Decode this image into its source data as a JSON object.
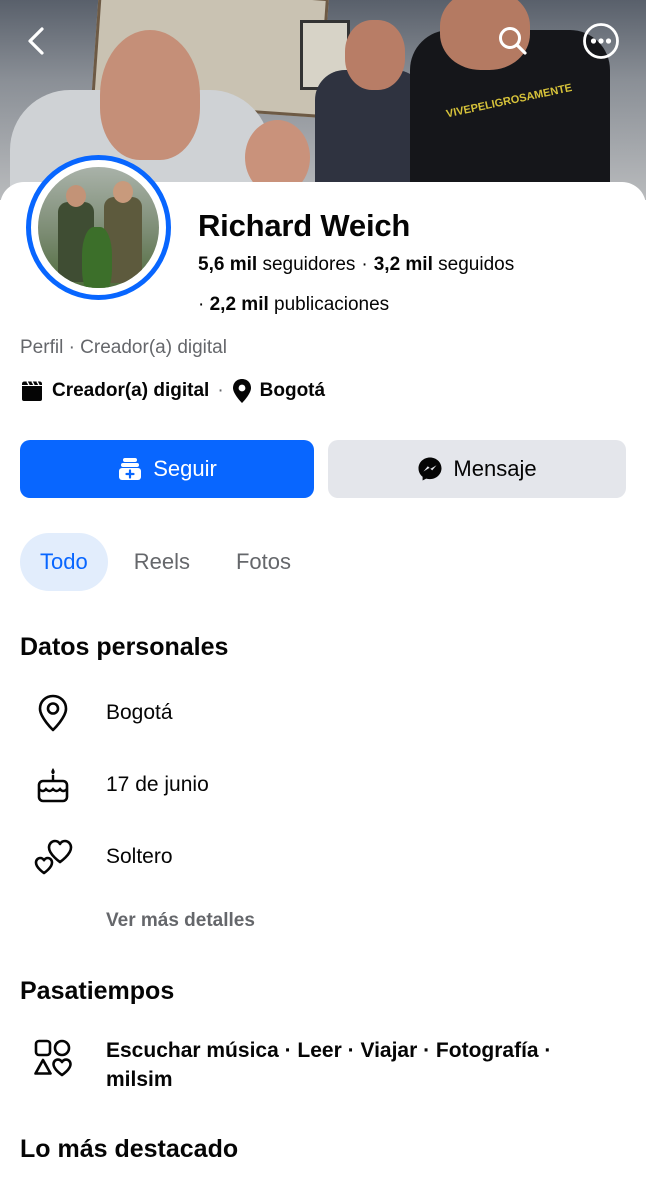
{
  "header": {
    "back_icon": "chevron-left-icon",
    "search_icon": "search-icon",
    "more_icon": "more-horizontal-icon",
    "shirt_print": "VIVEPELIGROSAMENTE"
  },
  "profile": {
    "name": "Richard Weich",
    "followers_count": "5,6 mil",
    "followers_label": "seguidores",
    "following_count": "3,2 mil",
    "following_label": "seguidos",
    "posts_count": "2,2 mil",
    "posts_label": "publicaciones",
    "separator": "·",
    "category_line": "Perfil · Creador(a) digital",
    "role": "Creador(a) digital",
    "location": "Bogotá"
  },
  "actions": {
    "follow_label": "Seguir",
    "message_label": "Mensaje",
    "accent_color": "#0866ff"
  },
  "tabs": [
    {
      "label": "Todo",
      "active": true
    },
    {
      "label": "Reels",
      "active": false
    },
    {
      "label": "Fotos",
      "active": false
    }
  ],
  "personal": {
    "title": "Datos personales",
    "items": [
      {
        "icon": "location-pin-icon",
        "text": "Bogotá"
      },
      {
        "icon": "birthday-cake-icon",
        "text": "17 de junio"
      },
      {
        "icon": "hearts-icon",
        "text": "Soltero"
      }
    ],
    "more_label": "Ver más detalles"
  },
  "hobbies": {
    "title": "Pasatiempos",
    "icon": "shapes-icon",
    "text": "Escuchar música · Leer · Viajar · Fotografía · milsim"
  },
  "highlights": {
    "title": "Lo más destacado"
  }
}
